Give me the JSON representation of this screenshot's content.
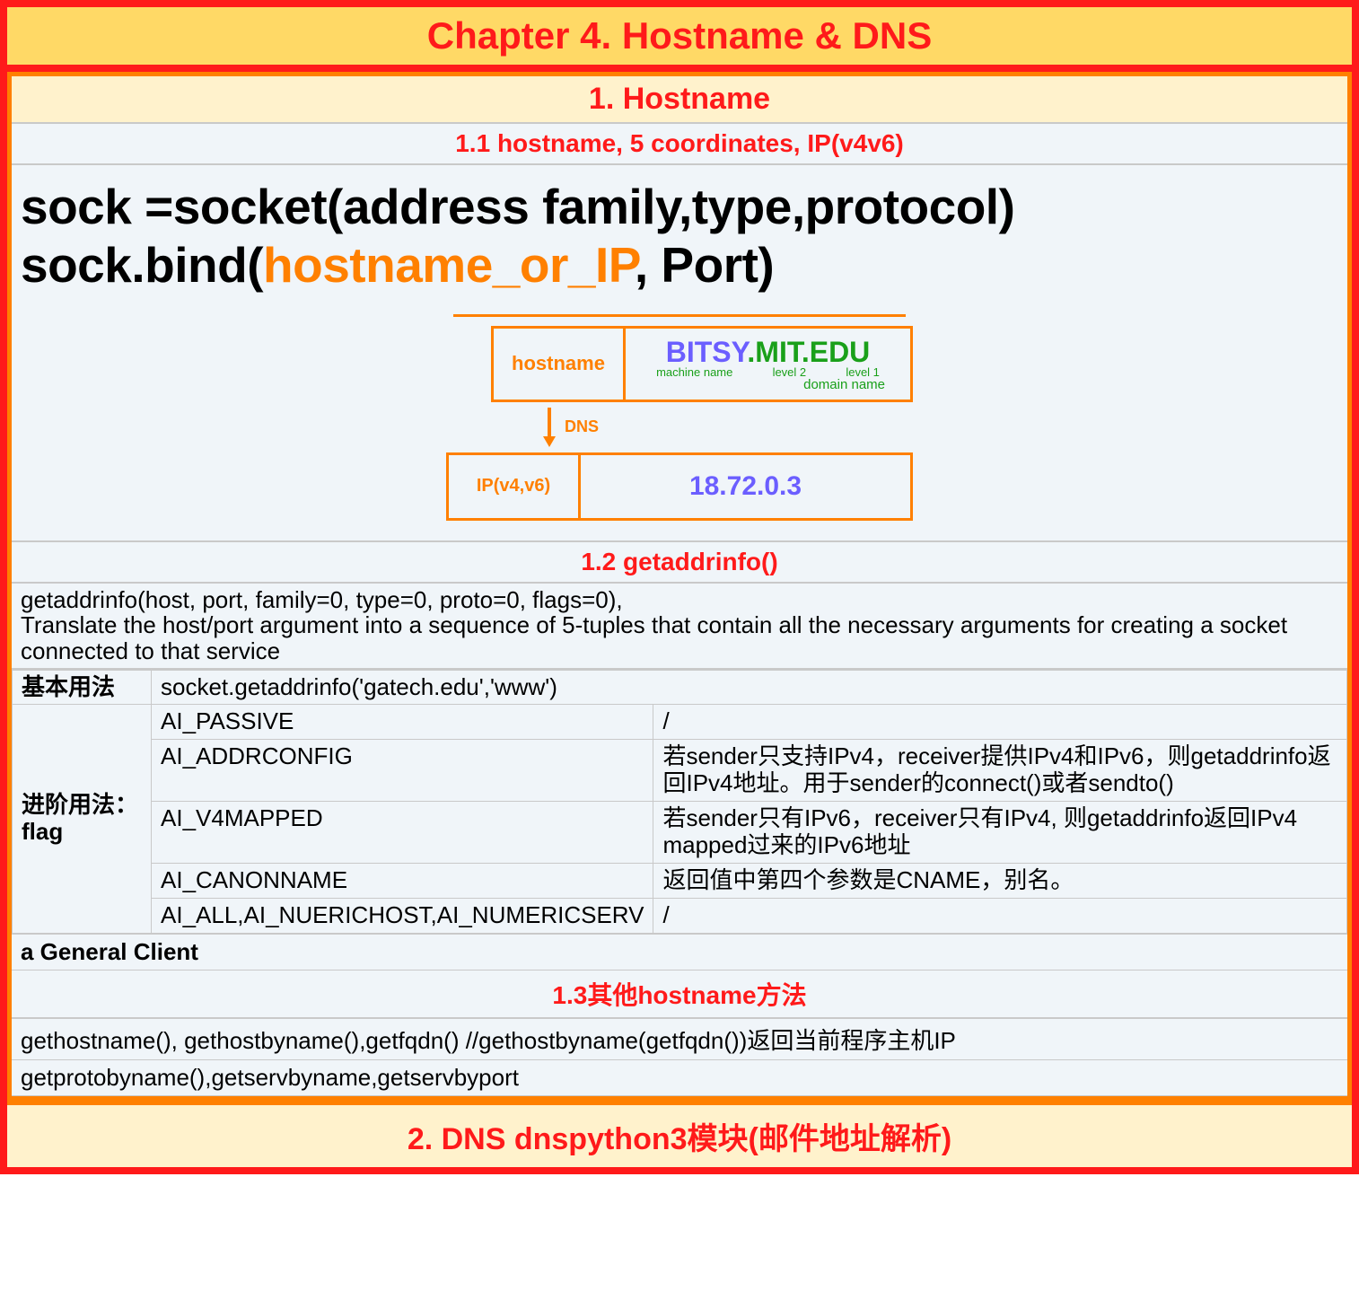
{
  "chapter_title": "Chapter 4. Hostname & DNS",
  "section1": {
    "title": "1. Hostname",
    "sub1": {
      "title": "1.1 hostname, 5 coordinates, IP(v4v6)",
      "code": {
        "line1_a": "sock =socket(address family,type,protocol)",
        "line2_a": "sock.bind(",
        "line2_b": "hostname_or_IP",
        "line2_c": ", Port)"
      },
      "diagram": {
        "hostname_label": "hostname",
        "bitsy": "BITSY",
        "dot1": ".",
        "mit": "MIT",
        "dot2": ".",
        "edu": "EDU",
        "machine_name": "machine name",
        "level2": "level 2",
        "level1": "level 1",
        "domain_name": "domain name",
        "dns": "DNS",
        "ip_label": "IP(v4,v6)",
        "ip_value": "18.72.0.3"
      }
    },
    "sub2": {
      "title": "1.2 getaddrinfo()",
      "desc": "getaddrinfo(host, port, family=0, type=0, proto=0, flags=0),\nTranslate the host/port argument into a sequence of 5-tuples that contain all the necessary arguments for creating a socket connected to that service",
      "basic_label": "基本用法",
      "basic_value": "socket.getaddrinfo('gatech.edu','www')",
      "adv_label": "进阶用法：flag",
      "flags": [
        {
          "name": "AI_PASSIVE",
          "desc": "/"
        },
        {
          "name": "AI_ADDRCONFIG",
          "desc": "若sender只支持IPv4，receiver提供IPv4和IPv6，则getaddrinfo返回IPv4地址。用于sender的connect()或者sendto()"
        },
        {
          "name": "AI_V4MAPPED",
          "desc": "若sender只有IPv6，receiver只有IPv4, 则getaddrinfo返回IPv4 mapped过来的IPv6地址"
        },
        {
          "name": "AI_CANONNAME",
          "desc": "返回值中第四个参数是CNAME，别名。"
        },
        {
          "name": "AI_ALL,AI_NUERICHOST,AI_NUMERICSERV",
          "desc": "/"
        }
      ],
      "general_client": "a General Client"
    },
    "sub3": {
      "title": "1.3其他hostname方法",
      "row1": "gethostname(), gethostbyname(),getfqdn()  //gethostbyname(getfqdn())返回当前程序主机IP",
      "row2": "getprotobyname(),getservbyname,getservbyport"
    }
  },
  "section2_title": "2. DNS dnspython3模块(邮件地址解析)"
}
